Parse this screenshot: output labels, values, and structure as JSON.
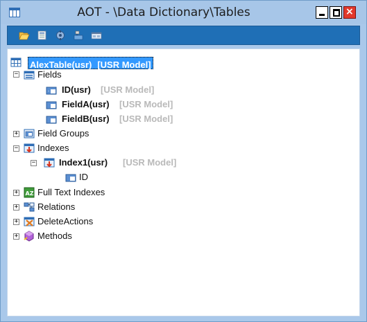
{
  "window": {
    "title": "AOT - \\Data Dictionary\\Tables",
    "icon": "table-icon"
  },
  "toolbar": {
    "buttons": [
      {
        "name": "open-folder-icon"
      },
      {
        "name": "properties-icon"
      },
      {
        "name": "compile-icon"
      },
      {
        "name": "import-icon"
      },
      {
        "name": "view-icon"
      }
    ]
  },
  "tree": {
    "root": {
      "label": "AlexTable(usr)",
      "model": "[USR Model]",
      "separator": " "
    },
    "fields": {
      "label": "Fields",
      "expander": "−",
      "items": [
        {
          "label": "ID(usr)",
          "model": "[USR Model]"
        },
        {
          "label": "FieldA(usr)",
          "model": "[USR Model]"
        },
        {
          "label": "FieldB(usr)",
          "model": "[USR Model]"
        }
      ]
    },
    "field_groups": {
      "label": "Field Groups",
      "expander": "+"
    },
    "indexes": {
      "label": "Indexes",
      "expander": "−",
      "index1": {
        "label": "Index1(usr)",
        "model": "[USR Model]",
        "expander": "−"
      },
      "index1_field": {
        "label": "ID"
      }
    },
    "full_text_indexes": {
      "label": "Full Text Indexes",
      "expander": "+"
    },
    "relations": {
      "label": "Relations",
      "expander": "+"
    },
    "delete_actions": {
      "label": "DeleteActions",
      "expander": "+"
    },
    "methods": {
      "label": "Methods",
      "expander": "+"
    }
  }
}
